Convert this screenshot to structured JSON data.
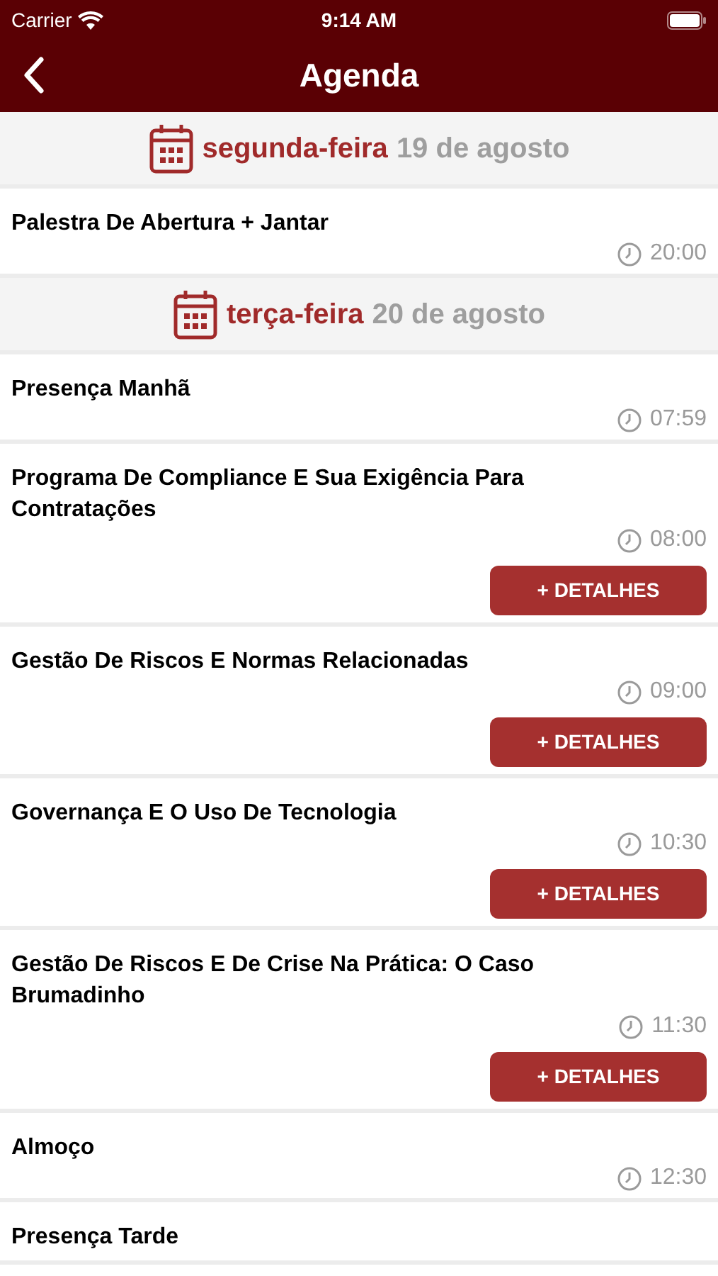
{
  "status_bar": {
    "carrier": "Carrier",
    "time": "9:14 AM"
  },
  "nav": {
    "title": "Agenda"
  },
  "days": [
    {
      "weekday": "segunda-feira",
      "date": "19 de agosto",
      "items": [
        {
          "title": "Palestra De Abertura + Jantar",
          "time": "20:00"
        }
      ]
    },
    {
      "weekday": "terça-feira",
      "date": "20 de agosto",
      "items": [
        {
          "title": "Presença Manhã",
          "time": "07:59"
        },
        {
          "title": "Programa De Compliance E Sua Exigência Para Contratações",
          "time": "08:00",
          "button": "+ DETALHES"
        },
        {
          "title": "Gestão De Riscos E Normas Relacionadas",
          "time": "09:00",
          "button": "+ DETALHES"
        },
        {
          "title": "Governança E O Uso De Tecnologia",
          "time": "10:30",
          "button": "+ DETALHES"
        },
        {
          "title": "Gestão De Riscos E De Crise Na Prática: O Caso Brumadinho",
          "time": "11:30",
          "button": "+ DETALHES"
        },
        {
          "title": "Almoço",
          "time": "12:30"
        },
        {
          "title": "Presença Tarde"
        }
      ]
    }
  ]
}
